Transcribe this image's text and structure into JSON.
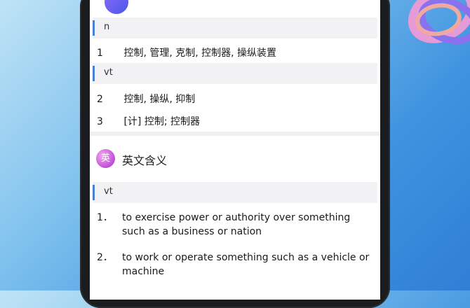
{
  "top": {
    "title_fragment": ""
  },
  "pos_sections": [
    {
      "pos": "n"
    },
    {
      "pos": "vt"
    }
  ],
  "cn_defs": [
    {
      "num": "1",
      "text": "控制, 管理, 克制, 控制器, 操纵装置"
    },
    {
      "num": "2",
      "text": "控制, 操纵, 抑制"
    },
    {
      "num": "3",
      "text": "[计] 控制; 控制器"
    }
  ],
  "english": {
    "icon_char": "英",
    "title": "英文含义",
    "pos": "vt",
    "defs": [
      {
        "num": "1．",
        "text": "to exercise power or authority over something such as a business or nation"
      },
      {
        "num": "2．",
        "text": "to work or operate something such as a vehicle or machine"
      }
    ]
  }
}
